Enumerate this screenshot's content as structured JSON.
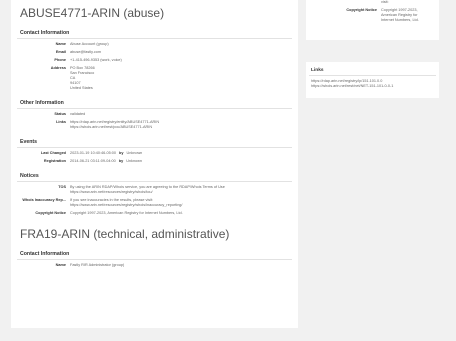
{
  "abuse": {
    "title": "ABUSE4771-ARIN (abuse)",
    "contact_header": "Contact Information",
    "contact": [
      {
        "label": "Name",
        "value": "Abuse Account (group)"
      },
      {
        "label": "Email",
        "value": "abuse@fastly.com"
      },
      {
        "label": "Phone",
        "value": "+1-415-496-9353 (work, voice)"
      },
      {
        "label": "Address",
        "value": "PO Box 78266\nSan Francisco\nCA\n94107\nUnited States"
      }
    ],
    "other_header": "Other Information",
    "other": [
      {
        "label": "Status",
        "value": "validated"
      },
      {
        "label": "Links",
        "value": "https://rdap.arin.net/registry/entity/ABUSE4771-ARIN\nhttps://whois.arin.net/rest/poc/ABUSE4771-ARIN"
      }
    ],
    "events_header": "Events",
    "events": [
      {
        "label": "Last Changed",
        "date": "2023-01-19 10:40:46-05:00",
        "by_label": "by",
        "by": "Unknown"
      },
      {
        "label": "Registration",
        "date": "2014-06-21 03:11:09-04:00",
        "by_label": "by",
        "by": "Unknown"
      }
    ],
    "notices_header": "Notices",
    "notices": [
      {
        "label": "TOS",
        "value": "By using the ARIN RDAP/Whois service, you are agreeing to the RDAP/Whois Terms of Use\nhttps://www.arin.net/resources/registry/whois/tou/"
      },
      {
        "label": "Whois Inaccuracy Rep...",
        "value": "If you see inaccuracies in the results, please visit:\nhttps://www.arin.net/resources/registry/whois/inaccuracy_reporting/"
      },
      {
        "label": "Copyright Notice",
        "value": "Copyright 1997-2023, American Registry for Internet Numbers, Ltd."
      }
    ]
  },
  "tech": {
    "title": "FRA19-ARIN (technical, administrative)",
    "contact_header": "Contact Information",
    "contact": [
      {
        "label": "Name",
        "value": "Fastly RIR Administrator (group)"
      }
    ]
  },
  "sidebar": {
    "top_rows": [
      {
        "label": "",
        "value": "visit:"
      },
      {
        "label": "Copyright Notice",
        "value": "Copyright 1997-2023,\nAmerican Registry for\nInternet Numbers, Ltd."
      }
    ],
    "links_header": "Links",
    "links": "https://rdap.arin.net/registry/ip/151.101.0.0\nhttps://whois.arin.net/rest/net/NET-151-101-0-0-1"
  }
}
